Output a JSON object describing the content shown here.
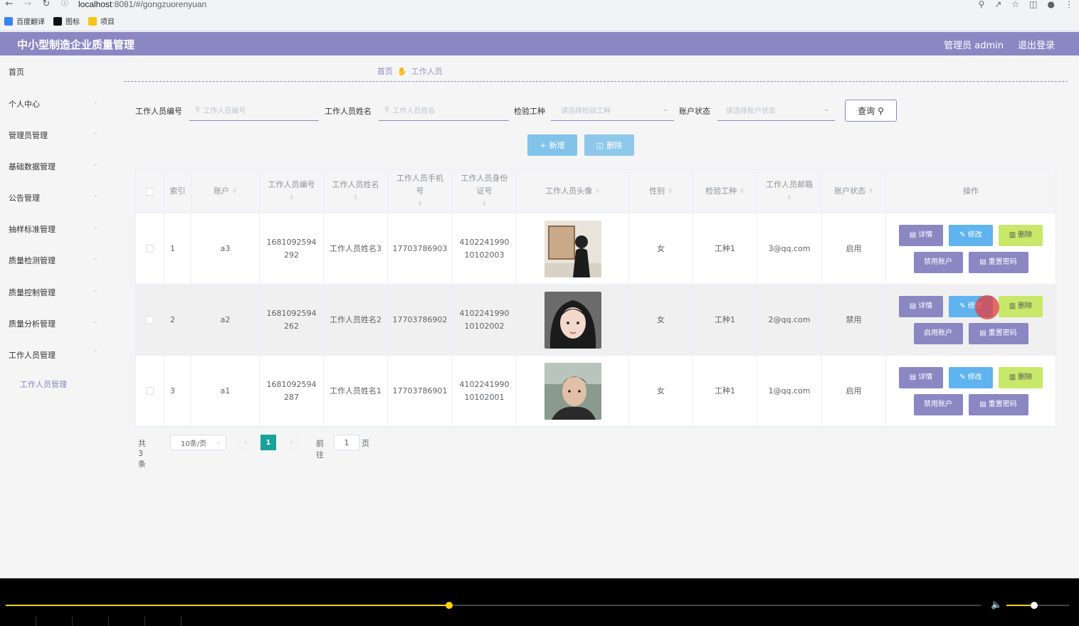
{
  "browser": {
    "url_host": "localhost",
    "url_rest": ":8081/#/gongzuorenyuan",
    "bookmarks": [
      {
        "label": "百度翻译",
        "color": "#3b82f6"
      },
      {
        "label": "图标",
        "color": "#111111"
      },
      {
        "label": "项目",
        "color": "#f5c518"
      }
    ]
  },
  "header": {
    "title": "中小型制造企业质量管理",
    "user": "管理员 admin",
    "logout": "退出登录",
    "color": "#8b87c3"
  },
  "sidebar": {
    "items": [
      {
        "label": "首页"
      },
      {
        "label": "个人中心"
      },
      {
        "label": "管理员管理"
      },
      {
        "label": "基础数据管理"
      },
      {
        "label": "公告管理"
      },
      {
        "label": "抽样标准管理"
      },
      {
        "label": "质量检测管理"
      },
      {
        "label": "质量控制管理"
      },
      {
        "label": "质量分析管理"
      },
      {
        "label": "工作人员管理"
      }
    ],
    "sub_item": "工作人员管理"
  },
  "breadcrumb": {
    "home": "首页",
    "current": "工作人员"
  },
  "search": {
    "no_label": "工作人员编号",
    "no_placeholder": "工作人员编号",
    "name_label": "工作人员姓名",
    "name_placeholder": "工作人员姓名",
    "type_label": "检验工种",
    "type_placeholder": "请选择检验工种",
    "status_label": "账户状态",
    "status_placeholder": "请选择账户状态",
    "query_label": "查询"
  },
  "actions": {
    "add": "新增",
    "delete": "删除"
  },
  "table": {
    "headers": {
      "index": "索引",
      "account": "账户",
      "no": "工作人员编号",
      "name": "工作人员姓名",
      "phone": "工作人员手机号",
      "idcard": "工作人员身份证号",
      "avatar": "工作人员头像",
      "gender": "性别",
      "worktype": "检验工种",
      "email": "工作人员邮箱",
      "status": "账户状态",
      "ops": "操作"
    },
    "op_labels": {
      "detail": "详情",
      "edit": "修改",
      "remove": "删除",
      "reset": "重置密码"
    },
    "rows": [
      {
        "index": "1",
        "account": "a3",
        "no": "1681092594292",
        "name": "工作人员姓名3",
        "phone": "17703786903",
        "idcard": "410224199010102003",
        "gender": "女",
        "worktype": "工种1",
        "email": "3@qq.com",
        "status": "启用",
        "toggle": "禁用账户"
      },
      {
        "index": "2",
        "account": "a2",
        "no": "1681092594262",
        "name": "工作人员姓名2",
        "phone": "17703786902",
        "idcard": "410224199010102002",
        "gender": "女",
        "worktype": "工种1",
        "email": "2@qq.com",
        "status": "禁用",
        "toggle": "启用账户"
      },
      {
        "index": "3",
        "account": "a1",
        "no": "1681092594287",
        "name": "工作人员姓名1",
        "phone": "17703786901",
        "idcard": "410224199010102001",
        "gender": "女",
        "worktype": "工种1",
        "email": "1@qq.com",
        "status": "启用",
        "toggle": "禁用账户"
      }
    ]
  },
  "pagination": {
    "total": "共 3 条",
    "page_size": "10条/页",
    "current": "1",
    "goto": "前往",
    "goto_value": "1",
    "page_suffix": "页"
  },
  "player": {
    "progress": 0.455,
    "volume": 0.44
  }
}
